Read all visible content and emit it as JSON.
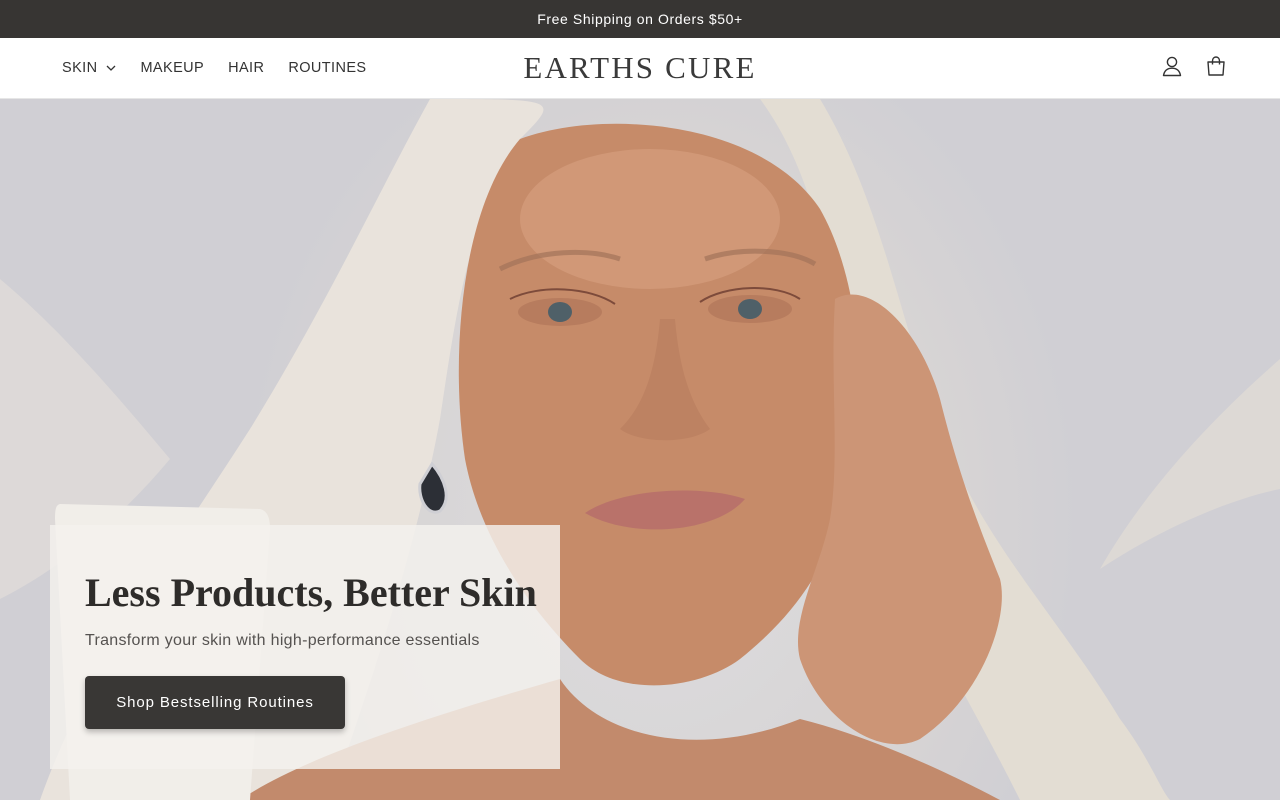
{
  "announcement": {
    "text": "Free Shipping on Orders $50+"
  },
  "nav": {
    "items": [
      {
        "label": "SKIN",
        "has_dropdown": true
      },
      {
        "label": "MAKEUP"
      },
      {
        "label": "HAIR"
      },
      {
        "label": "ROUTINES"
      }
    ]
  },
  "brand": {
    "logo_text": "EARTHS CURE"
  },
  "header_icons": [
    "account-icon",
    "cart-icon"
  ],
  "hero": {
    "title": "Less Products, Better Skin",
    "subtitle": "Transform your skin with high-performance essentials",
    "cta_label": "Shop Bestselling Routines"
  },
  "colors": {
    "announcement_bg": "#373533",
    "cta_bg": "#393735",
    "card_bg": "#f4f1ee"
  }
}
